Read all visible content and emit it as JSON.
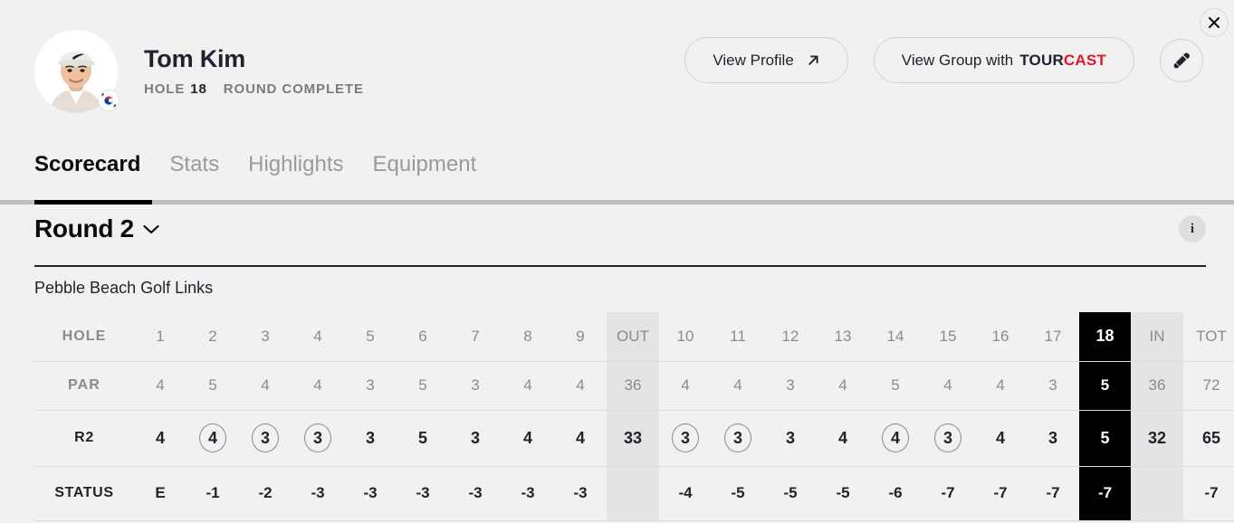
{
  "window": {
    "close_label": "×"
  },
  "player": {
    "name": "Tom Kim",
    "hole_label": "HOLE",
    "hole_number": "18",
    "round_status": "ROUND COMPLETE",
    "country": "South Korea"
  },
  "actions": {
    "view_profile": "View Profile",
    "view_group_prefix": "View Group with",
    "brand_tour": "TOUR",
    "brand_cast": "CAST",
    "brand_cast_color": "#e8112d",
    "pin_icon": "eyedropper-icon"
  },
  "tabs": [
    {
      "label": "Scorecard",
      "active": true
    },
    {
      "label": "Stats",
      "active": false
    },
    {
      "label": "Highlights",
      "active": false
    },
    {
      "label": "Equipment",
      "active": false
    }
  ],
  "round": {
    "title": "Round 2",
    "info_label": "i",
    "course": "Pebble Beach Golf Links"
  },
  "scorecard": {
    "row_labels": {
      "hole": "HOLE",
      "par": "PAR",
      "score": "R2",
      "status": "STATUS"
    },
    "columns": [
      {
        "key": "1",
        "type": "hole"
      },
      {
        "key": "2",
        "type": "hole"
      },
      {
        "key": "3",
        "type": "hole"
      },
      {
        "key": "4",
        "type": "hole"
      },
      {
        "key": "5",
        "type": "hole"
      },
      {
        "key": "6",
        "type": "hole"
      },
      {
        "key": "7",
        "type": "hole"
      },
      {
        "key": "8",
        "type": "hole"
      },
      {
        "key": "9",
        "type": "hole"
      },
      {
        "key": "OUT",
        "type": "agg"
      },
      {
        "key": "10",
        "type": "hole"
      },
      {
        "key": "11",
        "type": "hole"
      },
      {
        "key": "12",
        "type": "hole"
      },
      {
        "key": "13",
        "type": "hole"
      },
      {
        "key": "14",
        "type": "hole"
      },
      {
        "key": "15",
        "type": "hole"
      },
      {
        "key": "16",
        "type": "hole"
      },
      {
        "key": "17",
        "type": "hole"
      },
      {
        "key": "18",
        "type": "current"
      },
      {
        "key": "IN",
        "type": "agg"
      },
      {
        "key": "TOT",
        "type": "tot"
      }
    ],
    "par": [
      "4",
      "5",
      "4",
      "4",
      "3",
      "5",
      "3",
      "4",
      "4",
      "36",
      "4",
      "4",
      "3",
      "4",
      "5",
      "4",
      "4",
      "3",
      "5",
      "36",
      "72"
    ],
    "score": [
      "4",
      "4",
      "3",
      "3",
      "3",
      "5",
      "3",
      "4",
      "4",
      "33",
      "3",
      "3",
      "3",
      "4",
      "4",
      "3",
      "4",
      "3",
      "5",
      "32",
      "65"
    ],
    "score_circled": [
      false,
      true,
      true,
      true,
      false,
      false,
      false,
      false,
      false,
      false,
      true,
      true,
      false,
      false,
      true,
      true,
      false,
      false,
      false,
      false,
      false
    ],
    "status": [
      "E",
      "-1",
      "-2",
      "-3",
      "-3",
      "-3",
      "-3",
      "-3",
      "-3",
      "",
      "-4",
      "-5",
      "-5",
      "-5",
      "-6",
      "-7",
      "-7",
      "-7",
      "-7",
      "",
      "-7"
    ]
  }
}
